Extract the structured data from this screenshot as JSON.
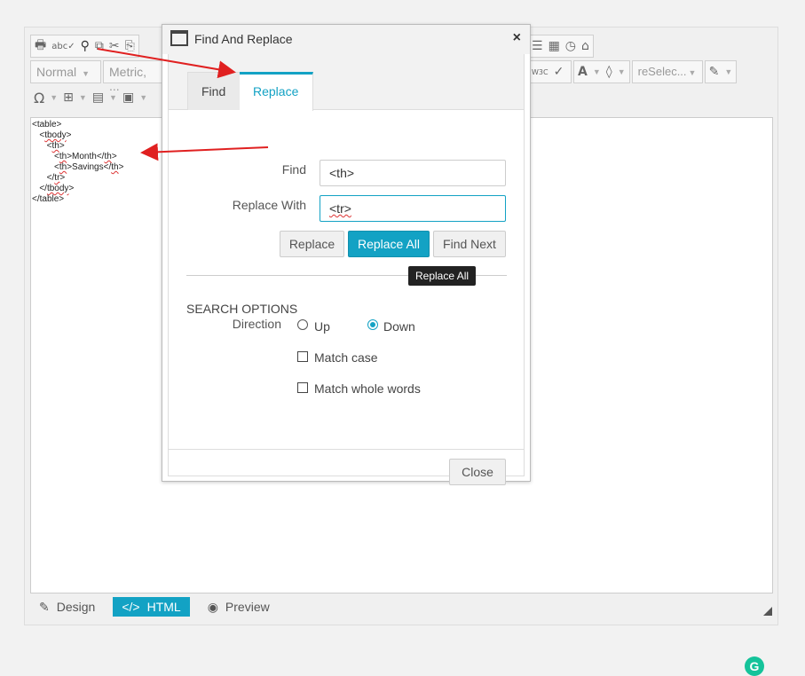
{
  "toolbar": {
    "row1_icons": [
      "print-icon",
      "spellcheck-icon",
      "find-binoculars-icon",
      "replace-icon",
      "cut-icon",
      "copy-icon"
    ],
    "row1_right_icons": [
      "align-icon",
      "calendar-icon",
      "clock-icon",
      "broom-icon"
    ],
    "paragraph_select": "Normal",
    "font_select": "Metric, ...",
    "validator_label": "W3C",
    "font_color_label": "A",
    "reselect_label": "reSelec...",
    "row3_icons": [
      "omega-icon",
      "table-icon",
      "list-icon",
      "embed-icon"
    ]
  },
  "code_lines": [
    {
      "indent": "",
      "text": "<table>",
      "squig": ""
    },
    {
      "indent": "   ",
      "pre": "<",
      "squig": "tbody",
      "post": ">"
    },
    {
      "indent": "      ",
      "pre": "<",
      "squig": "th",
      "post": ">"
    },
    {
      "indent": "         ",
      "pre": "<",
      "squig": "th",
      "post": ">Month</",
      "squig2": "th",
      "post2": ">"
    },
    {
      "indent": "         ",
      "pre": "<",
      "squig": "th",
      "post": ">Savings</",
      "squig2": "th",
      "post2": ">"
    },
    {
      "indent": "      ",
      "pre": "</",
      "squig": "tr",
      "post": ">"
    },
    {
      "indent": "   ",
      "pre": "</",
      "squig": "tbody",
      "post": ">"
    },
    {
      "indent": "",
      "text": "</table>",
      "squig": ""
    }
  ],
  "modes": {
    "design": "Design",
    "html": "HTML",
    "preview": "Preview"
  },
  "dialog": {
    "title": "Find And Replace",
    "close_glyph": "×",
    "tabs": {
      "find": "Find",
      "replace": "Replace"
    },
    "find_label": "Find",
    "find_value": "<th>",
    "replace_label": "Replace With",
    "replace_value": "<tr>",
    "buttons": {
      "replace": "Replace",
      "replace_all": "Replace All",
      "find_next": "Find Next",
      "close": "Close"
    },
    "tooltip": "Replace All",
    "search_options_title": "SEARCH OPTIONS",
    "direction_label": "Direction",
    "direction_up": "Up",
    "direction_down": "Down",
    "direction_selected": "Down",
    "match_case": "Match case",
    "match_case_checked": false,
    "match_whole_words": "Match whole words",
    "match_whole_words_checked": false
  },
  "colors": {
    "accent": "#13a2c4",
    "annotation_arrow": "#e02020",
    "grammarly": "#15c39a"
  }
}
